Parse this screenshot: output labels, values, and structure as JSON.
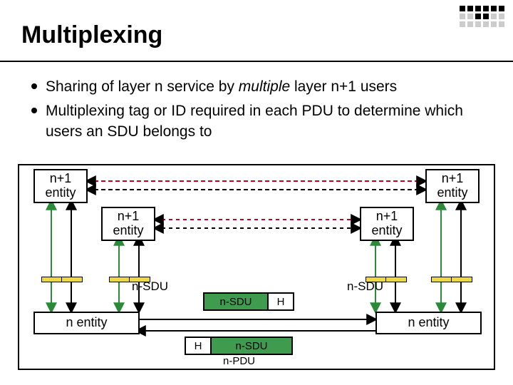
{
  "title": "Multiplexing",
  "bullets": [
    "Sharing of layer n service by multiple layer n+1 users",
    "Multiplexing tag or ID required in each PDU to determine which users an SDU belongs to"
  ],
  "italic_word": "multiple",
  "labels": {
    "np1": "n+1\nentity",
    "n": "n entity",
    "sdu": "n-SDU",
    "h": "H",
    "pdu": "n-PDU"
  }
}
